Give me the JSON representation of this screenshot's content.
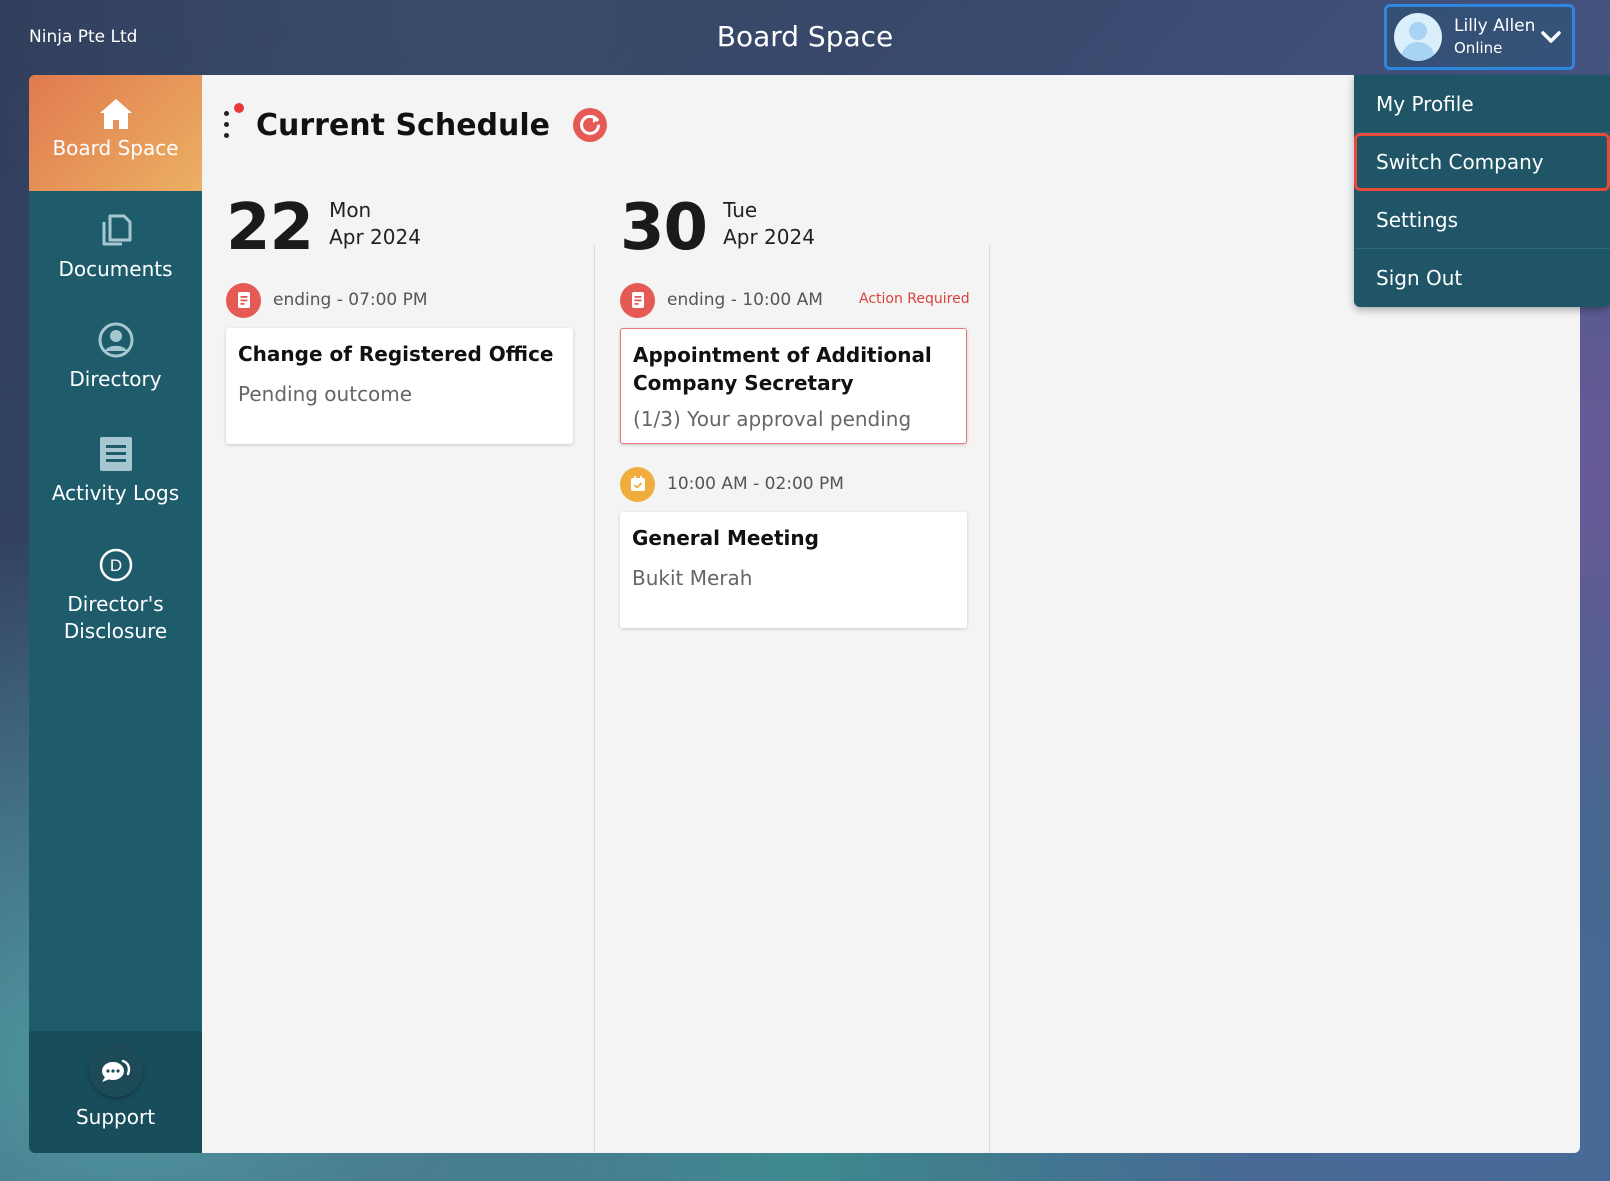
{
  "header": {
    "company": "Ninja Pte Ltd",
    "title": "Board Space",
    "user": {
      "name": "Lilly Allen",
      "status": "Online"
    }
  },
  "sidebar": {
    "items": [
      {
        "label": "Board Space",
        "icon": "home-icon",
        "active": true
      },
      {
        "label": "Documents",
        "icon": "documents-icon"
      },
      {
        "label": "Directory",
        "icon": "user-circle-icon"
      },
      {
        "label": "Activity Logs",
        "icon": "list-icon"
      },
      {
        "label": "Director's Disclosure",
        "icon": "d-circle-icon"
      }
    ],
    "support": {
      "label": "Support",
      "icon": "chat-icon"
    }
  },
  "schedule": {
    "title": "Current Schedule",
    "days": [
      {
        "day": "22",
        "weekday": "Mon",
        "month": "Apr 2024",
        "items": [
          {
            "time": "ending - 07:00 PM",
            "title": "Change of Registered Office",
            "subtitle": "Pending outcome"
          }
        ]
      },
      {
        "day": "30",
        "weekday": "Tue",
        "month": "Apr 2024",
        "items": [
          {
            "time": "ending - 10:00 AM",
            "flag": "Action Required",
            "title": "Appointment of Additional Company Secretary",
            "subtitle": "(1/3) Your approval pending"
          },
          {
            "time": "10:00 AM - 02:00 PM",
            "title": "General Meeting",
            "subtitle": "Bukit Merah"
          }
        ]
      }
    ]
  },
  "user_menu": {
    "items": [
      {
        "label": "My Profile"
      },
      {
        "label": "Switch Company",
        "highlighted": true
      },
      {
        "label": "Settings"
      },
      {
        "label": "Sign Out"
      }
    ]
  },
  "colors": {
    "sidebar": "#1e5c6c",
    "active_gradient_start": "#e07a4f",
    "active_gradient_end": "#ecb063",
    "menu": "#1f5566",
    "highlight": "#e84a3a",
    "accent_red": "#e55a55",
    "accent_yellow": "#f0ad3e"
  }
}
